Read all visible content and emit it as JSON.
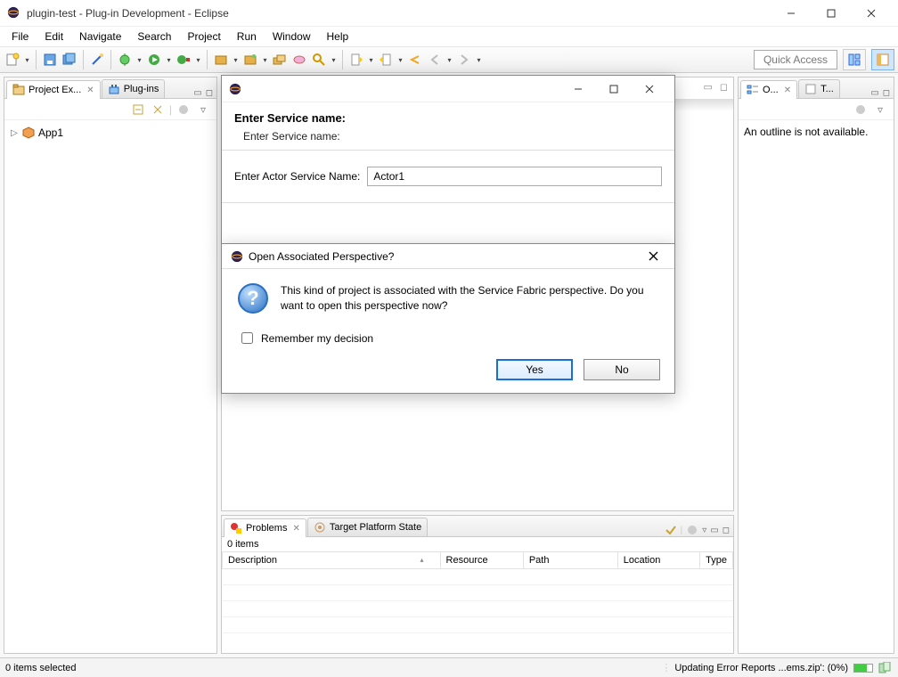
{
  "window": {
    "title": "plugin-test - Plug-in Development - Eclipse"
  },
  "menu": {
    "items": [
      "File",
      "Edit",
      "Navigate",
      "Search",
      "Project",
      "Run",
      "Window",
      "Help"
    ]
  },
  "toolbar": {
    "quick_access": "Quick Access"
  },
  "left_view": {
    "tab1": "Project Ex...",
    "tab2": "Plug-ins",
    "tree_item": "App1"
  },
  "right_view": {
    "tab1": "O...",
    "tab2": "T...",
    "message": "An outline is not available."
  },
  "problems_view": {
    "tab1": "Problems",
    "tab2": "Target Platform State",
    "count": "0 items",
    "columns": [
      "Description",
      "Resource",
      "Path",
      "Location",
      "Type"
    ]
  },
  "wizard": {
    "heading": "Enter Service name:",
    "subheading": "Enter Service name:",
    "label": "Enter Actor Service Name:",
    "value": "Actor1"
  },
  "perspective_dialog": {
    "title": "Open Associated Perspective?",
    "message": "This kind of project is associated with the Service Fabric perspective.  Do you want to open this perspective now?",
    "remember": "Remember my decision",
    "yes": "Yes",
    "no": "No"
  },
  "status": {
    "left": "0 items selected",
    "right": "Updating Error Reports ...ems.zip': (0%)"
  }
}
